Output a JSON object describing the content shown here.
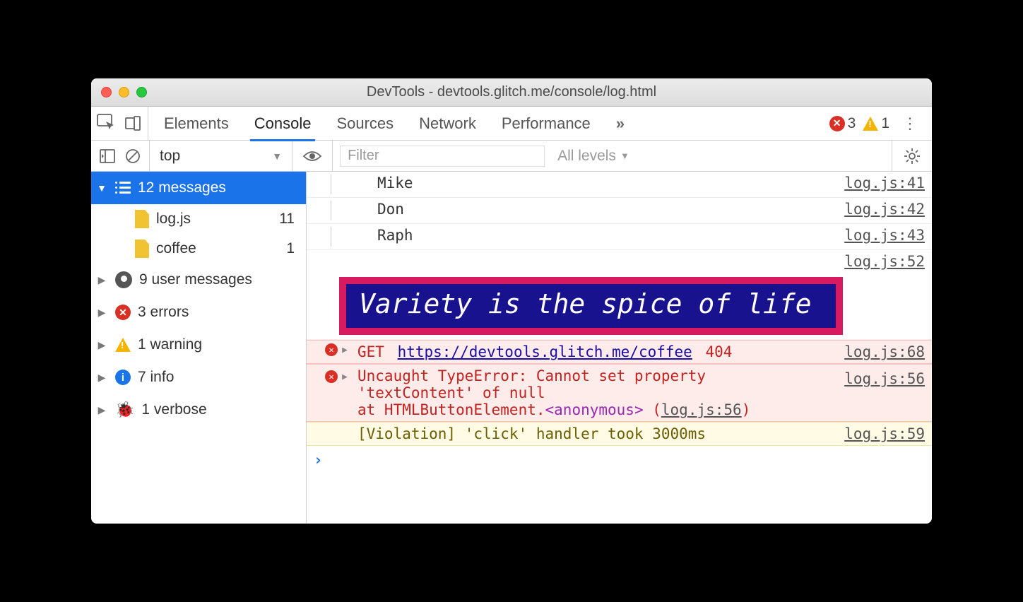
{
  "window": {
    "title": "DevTools - devtools.glitch.me/console/log.html"
  },
  "tabs": {
    "elements": "Elements",
    "console": "Console",
    "sources": "Sources",
    "network": "Network",
    "performance": "Performance",
    "more": "»",
    "error_count": "3",
    "warn_count": "1"
  },
  "filter": {
    "context": "top",
    "chevron": "▼",
    "placeholder": "Filter",
    "levels": "All levels",
    "levels_chevron": "▼"
  },
  "sidebar": {
    "messages": {
      "label": "12 messages"
    },
    "files": [
      {
        "name": "log.js",
        "count": "11"
      },
      {
        "name": "coffee",
        "count": "1"
      }
    ],
    "user": "9 user messages",
    "errors": "3 errors",
    "warning": "1 warning",
    "info": "7 info",
    "verbose": "1 verbose"
  },
  "console": {
    "rows": [
      {
        "text": "Mike",
        "src": "log.js:41"
      },
      {
        "text": "Don",
        "src": "log.js:42"
      },
      {
        "text": "Raph",
        "src": "log.js:43"
      }
    ],
    "banner_src": "log.js:52",
    "banner_text": "Variety is the spice of life",
    "net": {
      "method": "GET",
      "url": "https://devtools.glitch.me/coffee",
      "status": "404",
      "src": "log.js:68"
    },
    "exc": {
      "line1": "Uncaught TypeError: Cannot set property",
      "line2": "'textContent' of null",
      "line3a": "    at HTMLButtonElement.",
      "anon": "<anonymous>",
      "line3b": " (",
      "link": "log.js:56",
      "line3c": ")",
      "src": "log.js:56"
    },
    "violation": {
      "text": "[Violation] 'click' handler took 3000ms",
      "src": "log.js:59"
    },
    "prompt": "›"
  }
}
